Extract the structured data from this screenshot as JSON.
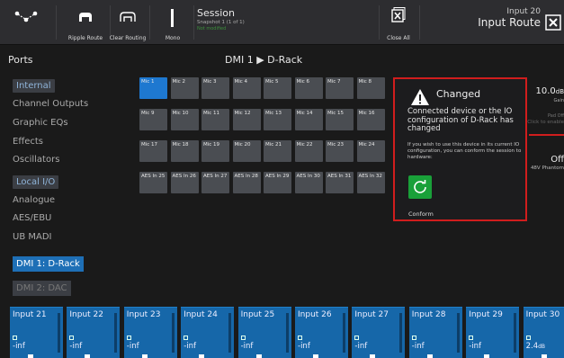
{
  "toolbar": {
    "ripple_label": "Ripple Route",
    "clear_label": "Clear Routing",
    "mono_label": "Mono",
    "session_title": "Session",
    "session_snapshot": "Snapshot 1 (1 of 1)",
    "session_status": "Not modified",
    "close_all_label": "Close All",
    "input_name": "Input 20",
    "input_route_title": "Input Route"
  },
  "ports": {
    "title": "Ports",
    "items": [
      {
        "label": "Internal",
        "kind": "category"
      },
      {
        "label": "Channel Outputs",
        "kind": "item"
      },
      {
        "label": "Graphic EQs",
        "kind": "item"
      },
      {
        "label": "Effects",
        "kind": "item"
      },
      {
        "label": "Oscillators",
        "kind": "item"
      },
      {
        "label": "Local I/O",
        "kind": "category"
      },
      {
        "label": "Analogue",
        "kind": "item"
      },
      {
        "label": "AES/EBU",
        "kind": "item"
      },
      {
        "label": "UB MADI",
        "kind": "item"
      },
      {
        "label": "DMI 1: D-Rack",
        "kind": "selected"
      },
      {
        "label": "DMI 2: DAC",
        "kind": "disabled"
      }
    ]
  },
  "dmi_title": "DMI 1 ▶ D-Rack",
  "grid": [
    [
      "Mic 1",
      "Mic 2",
      "Mic 3",
      "Mic 4",
      "Mic 5",
      "Mic 6",
      "Mic 7",
      "Mic 8"
    ],
    [
      "Mic 9",
      "Mic 10",
      "Mic 11",
      "Mic 12",
      "Mic 13",
      "Mic 14",
      "Mic 15",
      "Mic 16"
    ],
    [
      "Mic 17",
      "Mic 18",
      "Mic 19",
      "Mic 20",
      "Mic 21",
      "Mic 22",
      "Mic 23",
      "Mic 24"
    ],
    [
      "AES In 25",
      "AES In 26",
      "AES In 27",
      "AES In 28",
      "AES In 29",
      "AES In 30",
      "AES In 31",
      "AES In 32"
    ]
  ],
  "grid_selected": "Mic 1",
  "right_panel": {
    "gain_value": "10.0",
    "gain_unit": "dB",
    "gain_label": "Gain",
    "pad_label": "Pad Off",
    "pad_hint": "Click to enable",
    "phantom_value": "Off",
    "phantom_label": "48V Phantom"
  },
  "popup": {
    "heading": "Changed",
    "message": "Connected device or the IO configuration of D-Rack has changed",
    "sub": "If you wish to use this device in its current IO configuration, you can conform the session to hardware:",
    "button_label": "Conform"
  },
  "strips": [
    {
      "name": "Input 21",
      "value": "-inf",
      "unit": ""
    },
    {
      "name": "Input 22",
      "value": "-inf",
      "unit": ""
    },
    {
      "name": "Input 23",
      "value": "-inf",
      "unit": ""
    },
    {
      "name": "Input 24",
      "value": "-inf",
      "unit": ""
    },
    {
      "name": "Input 25",
      "value": "-inf",
      "unit": ""
    },
    {
      "name": "Input 26",
      "value": "-inf",
      "unit": ""
    },
    {
      "name": "Input 27",
      "value": "-inf",
      "unit": ""
    },
    {
      "name": "Input 28",
      "value": "-inf",
      "unit": ""
    },
    {
      "name": "Input 29",
      "value": "-inf",
      "unit": ""
    },
    {
      "name": "Input 30",
      "value": "2.4",
      "unit": "dB"
    }
  ],
  "colors": {
    "accent_blue": "#1e78d0",
    "alert_red": "#d01d1d",
    "confirm_green": "#19a039"
  }
}
